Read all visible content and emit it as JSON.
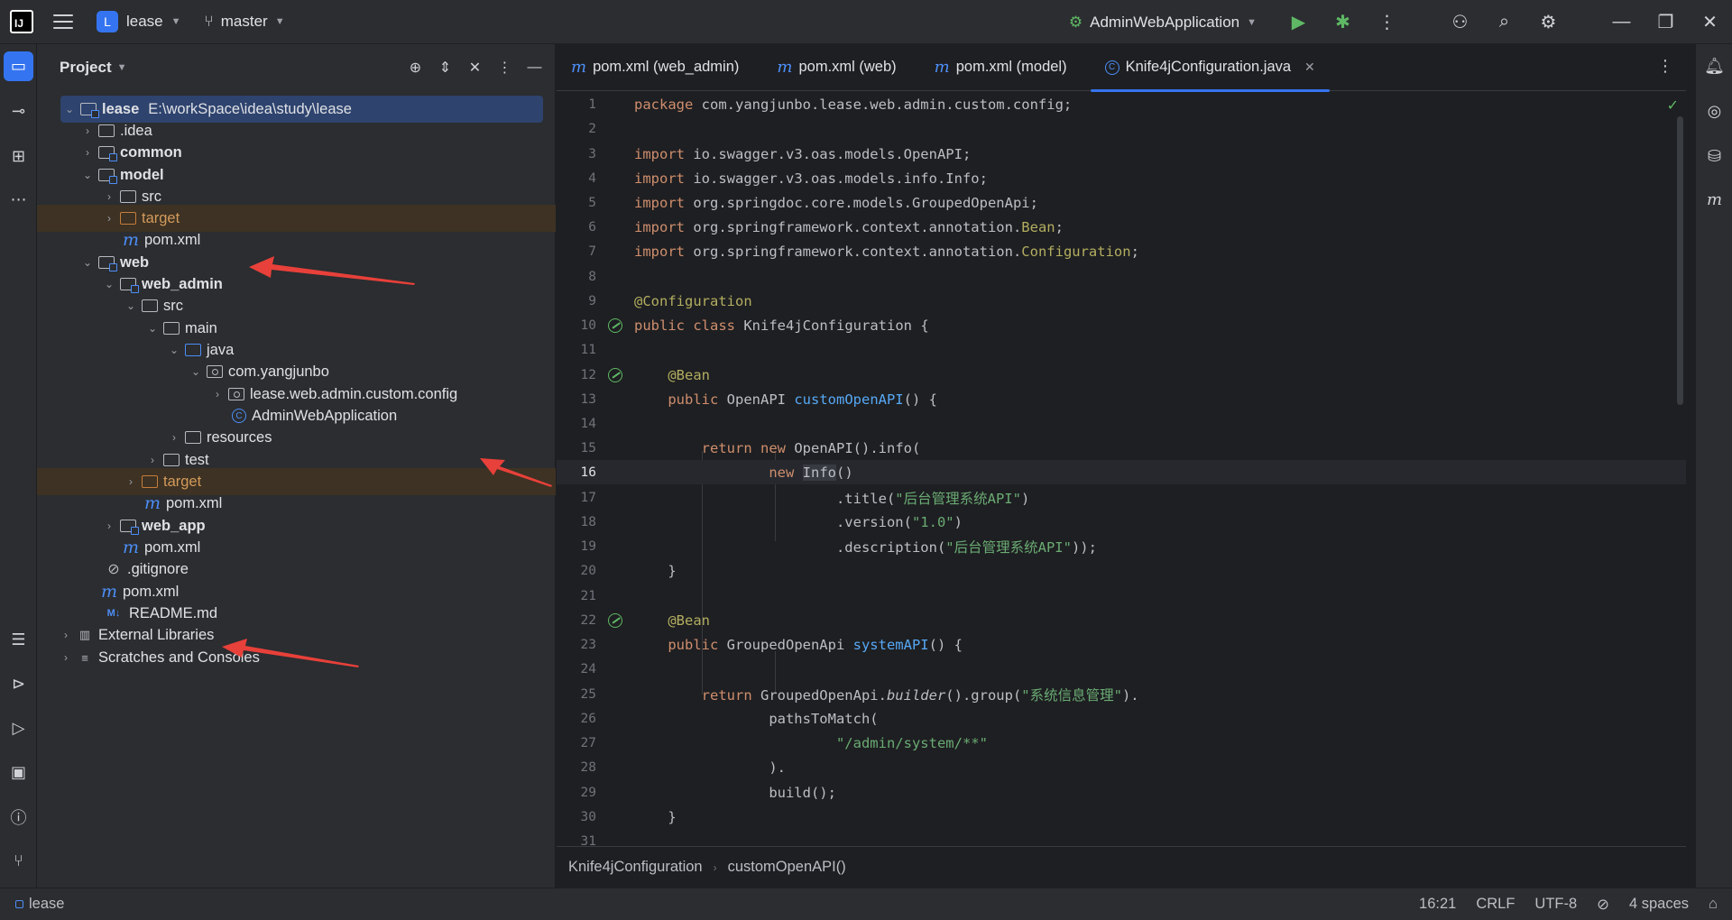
{
  "titlebar": {
    "project_badge": "L",
    "project_name": "lease",
    "branch": "master",
    "run_config": "AdminWebApplication"
  },
  "project_panel": {
    "title": "Project",
    "tree": [
      {
        "label": "lease",
        "extra": "E:\\workSpace\\idea\\study\\lease"
      },
      {
        "label": ".idea"
      },
      {
        "label": "common"
      },
      {
        "label": "model"
      },
      {
        "label": "src"
      },
      {
        "label": "target"
      },
      {
        "label": "pom.xml"
      },
      {
        "label": "web"
      },
      {
        "label": "web_admin"
      },
      {
        "label": "src"
      },
      {
        "label": "main"
      },
      {
        "label": "java"
      },
      {
        "label": "com.yangjunbo"
      },
      {
        "label": "lease.web.admin.custom.config"
      },
      {
        "label": "AdminWebApplication"
      },
      {
        "label": "resources"
      },
      {
        "label": "test"
      },
      {
        "label": "target"
      },
      {
        "label": "pom.xml"
      },
      {
        "label": "web_app"
      },
      {
        "label": "pom.xml"
      },
      {
        "label": ".gitignore"
      },
      {
        "label": "pom.xml"
      },
      {
        "label": "README.md"
      },
      {
        "label": "External Libraries"
      },
      {
        "label": "Scratches and Consoles"
      }
    ]
  },
  "editor": {
    "tabs": [
      {
        "label": "pom.xml (web_admin)"
      },
      {
        "label": "pom.xml (web)"
      },
      {
        "label": "pom.xml (model)"
      },
      {
        "label": "Knife4jConfiguration.java"
      }
    ],
    "line_numbers": [
      "1",
      "2",
      "3",
      "4",
      "5",
      "6",
      "7",
      "8",
      "9",
      "10",
      "11",
      "12",
      "13",
      "14",
      "15",
      "16",
      "17",
      "18",
      "19",
      "20",
      "21",
      "22",
      "23",
      "24",
      "25",
      "26",
      "27",
      "28",
      "29",
      "30",
      "31"
    ],
    "code": {
      "pkg_kw": "package",
      "pkg": " com.yangjunbo.lease.web.admin.custom.config;",
      "imp": "import",
      "i1": " io.swagger.v3.oas.models.OpenAPI;",
      "i2": " io.swagger.v3.oas.models.info.Info;",
      "i3": " org.springdoc.core.models.GroupedOpenApi;",
      "i4a": " org.springframework.context.annotation.",
      "i4b": "Bean",
      "i4c": ";",
      "i5a": " org.springframework.context.annotation.",
      "i5b": "Configuration",
      "i5c": ";",
      "ann_config": "@Configuration",
      "l10_kw1": "public",
      "l10_kw2": "class",
      "l10_rest": " Knife4jConfiguration {",
      "ann_bean": "@Bean",
      "l13_kw": "public",
      "l13_type": " OpenAPI ",
      "l13_fn": "customOpenAPI",
      "l13_rest": "() {",
      "l15_kw1": "return",
      "l15_kw2": "new",
      "l15_rest": " OpenAPI().info(",
      "l16_kw": "new",
      "l16_cls": "Info",
      "l16_rest": "()",
      "l17a": ".title(",
      "l17s": "\"后台管理系统API\"",
      "l17b": ")",
      "l18a": ".version(",
      "l18s": "\"1.0\"",
      "l18b": ")",
      "l19a": ".description(",
      "l19s": "\"后台管理系统API\"",
      "l19b": "));",
      "brace": "}",
      "l23_kw": "public",
      "l23_type": " GroupedOpenApi ",
      "l23_fn": "systemAPI",
      "l23_rest": "() {",
      "l25_kw": "return",
      "l25a": " GroupedOpenApi.",
      "l25i": "builder",
      "l25b": "().group(",
      "l25s": "\"系统信息管理\"",
      "l25c": ").",
      "l26": "pathsToMatch(",
      "l27s": "\"/admin/system/**\"",
      "l28": ").",
      "l29": "build();"
    },
    "breadcrumb": [
      "Knife4jConfiguration",
      "customOpenAPI()"
    ]
  },
  "statusbar": {
    "project": "lease",
    "position": "16:21",
    "line_sep": "CRLF",
    "encoding": "UTF-8",
    "indent": "4 spaces"
  },
  "colors": {
    "accent": "#3574f0",
    "annotation_arrow": "#e8403a"
  }
}
